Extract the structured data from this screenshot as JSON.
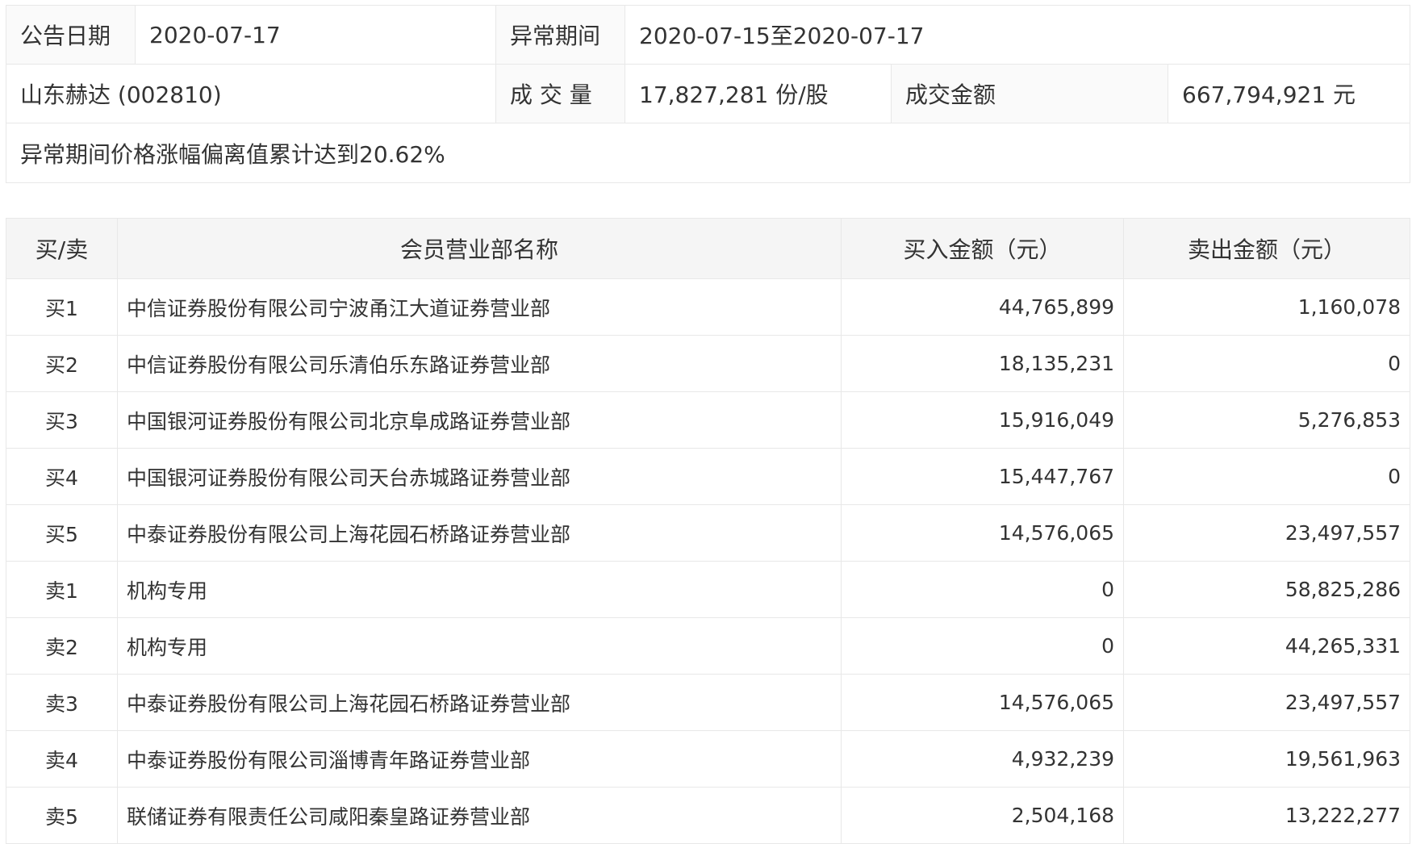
{
  "info": {
    "date_label": "公告日期",
    "date_value": "2020-07-17",
    "period_label": "异常期间",
    "period_value": "2020-07-15至2020-07-17",
    "stock": "山东赫达 (002810)",
    "volume_label": "成 交 量",
    "volume_value": "17,827,281 份/股",
    "amount_label": "成交金额",
    "amount_value": "667,794,921 元",
    "note": "异常期间价格涨幅偏离值累计达到20.62%"
  },
  "table": {
    "headers": [
      "买/卖",
      "会员营业部名称",
      "买入金额（元）",
      "卖出金额（元）"
    ],
    "rows": [
      {
        "side": "买1",
        "name": "中信证券股份有限公司宁波甬江大道证券营业部",
        "buy": "44,765,899",
        "sell": "1,160,078"
      },
      {
        "side": "买2",
        "name": "中信证券股份有限公司乐清伯乐东路证券营业部",
        "buy": "18,135,231",
        "sell": "0"
      },
      {
        "side": "买3",
        "name": "中国银河证券股份有限公司北京阜成路证券营业部",
        "buy": "15,916,049",
        "sell": "5,276,853"
      },
      {
        "side": "买4",
        "name": "中国银河证券股份有限公司天台赤城路证券营业部",
        "buy": "15,447,767",
        "sell": "0"
      },
      {
        "side": "买5",
        "name": "中泰证券股份有限公司上海花园石桥路证券营业部",
        "buy": "14,576,065",
        "sell": "23,497,557"
      },
      {
        "side": "卖1",
        "name": "机构专用",
        "buy": "0",
        "sell": "58,825,286"
      },
      {
        "side": "卖2",
        "name": "机构专用",
        "buy": "0",
        "sell": "44,265,331"
      },
      {
        "side": "卖3",
        "name": "中泰证券股份有限公司上海花园石桥路证券营业部",
        "buy": "14,576,065",
        "sell": "23,497,557"
      },
      {
        "side": "卖4",
        "name": "中泰证券股份有限公司淄博青年路证券营业部",
        "buy": "4,932,239",
        "sell": "19,561,963"
      },
      {
        "side": "卖5",
        "name": "联储证券有限责任公司咸阳秦皇路证券营业部",
        "buy": "2,504,168",
        "sell": "13,222,277"
      }
    ]
  }
}
